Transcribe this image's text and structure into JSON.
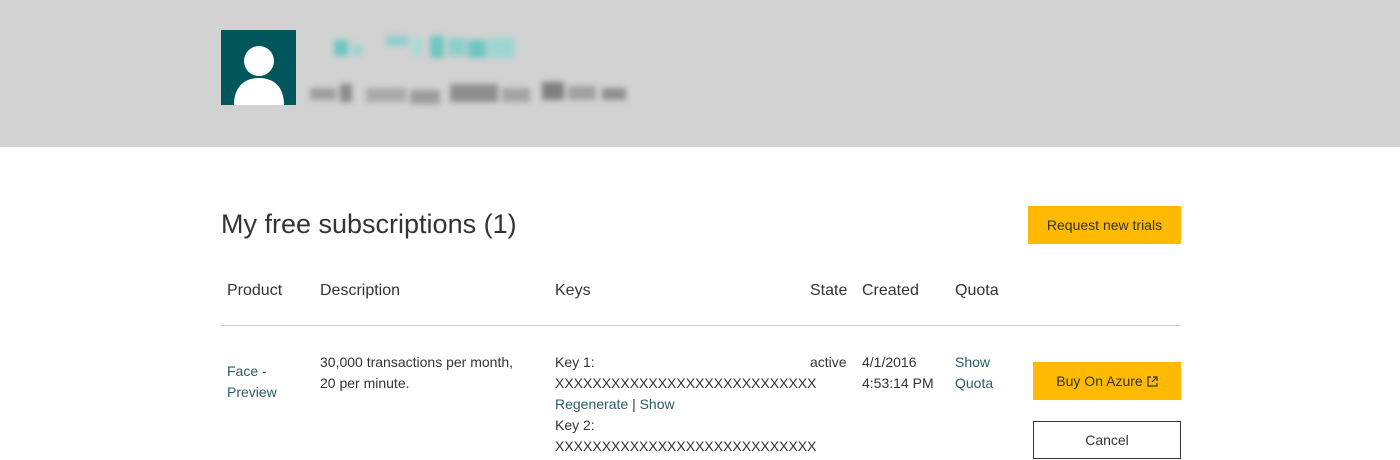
{
  "profile": {
    "avatar_icon": "user-silhouette-icon",
    "name_redacted": true,
    "email_redacted": true
  },
  "page": {
    "title": "My free subscriptions (1)",
    "request_button": "Request new trials"
  },
  "table": {
    "headers": {
      "product": "Product",
      "description": "Description",
      "keys": "Keys",
      "state": "State",
      "created": "Created",
      "quota": "Quota"
    },
    "rows": [
      {
        "product_line1": "Face -",
        "product_line2": "Preview",
        "description_line1": "30,000 transactions per month,",
        "description_line2": "20 per minute.",
        "key1_label": "Key 1:",
        "key1_value": "XXXXXXXXXXXXXXXXXXXXXXXXXXXX",
        "regenerate": "Regenerate",
        "separator": "|",
        "show": "Show",
        "key2_label": "Key 2:",
        "key2_value": "XXXXXXXXXXXXXXXXXXXXXXXXXXXX",
        "state": "active",
        "created_date": "4/1/2016",
        "created_time": "4:53:14 PM",
        "quota_line1": "Show",
        "quota_line2": "Quota",
        "buy_button": "Buy On Azure",
        "buy_icon": "external-link-icon",
        "cancel_button": "Cancel"
      }
    ]
  },
  "colors": {
    "header_bg": "#d2d2d2",
    "avatar_bg": "#00565a",
    "accent_yellow": "#ffb900",
    "link": "#2a5e63"
  }
}
